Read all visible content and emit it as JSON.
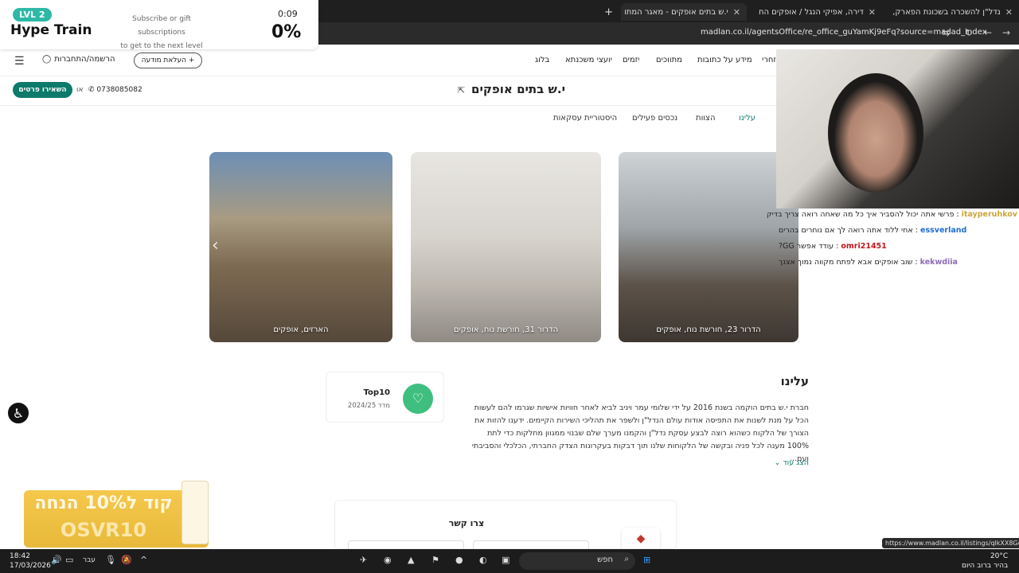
{
  "browser": {
    "tabs": [
      {
        "label": "נדל\"ן להשכרה בשכונת הפארק,"
      },
      {
        "label": "דירה, אפיקי הנגל / אופקים הח"
      },
      {
        "label": "י.ש בתים אופקים - מאגר המתו"
      }
    ],
    "url": "madlan.co.il/agentsOffice/re_office_guYamKj9eFq?source=madad_index"
  },
  "hype_train": {
    "level": "LVL 2",
    "title": "Hype Train",
    "subtitle_line1": "Subscribe or gift subscriptions",
    "subtitle_line2": "to get to the next level",
    "timer": "0:09",
    "percent": "0%"
  },
  "site_nav": {
    "links": [
      "בלוג",
      "יועצי משכנתא",
      "יזמים",
      "מתווכים",
      "מידע על כתובות",
      "זחרי"
    ],
    "login": "הרשמה/התחברות",
    "upload": "העלאת מודעה"
  },
  "office": {
    "name": "י.ש בתים אופקים",
    "leave_details": "השאירו פרטים",
    "or": "או",
    "phone": "0738085082"
  },
  "section_tabs": [
    "עלינו",
    "הצוות",
    "נכסים פעילים",
    "היסטוריית עסקאות"
  ],
  "cards": [
    {
      "caption": "הארזים, אופקים"
    },
    {
      "caption": "הדרור 31, חורשת נוח, אופקים"
    },
    {
      "caption": "הדרור 23, חורשת נוח, אופקים"
    }
  ],
  "about": {
    "title": "עלינו",
    "text": "חברת י.ש בתים הוקמה בשנת 2016 על ידי שלומי עמר ויניב לביא לאחר חוויות אישיות שגרמו להם לעשות הכל על מנת לשנות את התפיסה אודות עולם הנדל\"ן ולשפר את תהליכי השירות הקיימים. ידענו להזות את הצורך של הלקוח כשהוא רוצה לבצע עסקת נדל\"ן והקמנו מערך שלם שבנוי ממגוון מחלקות כדי לתת 100% מענה לכל פניה ובקשה של הלקוחות שלנו תוך דבקות בעקרונות הצדק החברתי, הכלכלי והסביבתי ועם...",
    "show_more": "הצג עוד",
    "badge_title": "Top10",
    "badge_sub": "מדד 2024/25"
  },
  "contact": {
    "title": "צרו קשר"
  },
  "ad": {
    "line1": "קוד ל10% הנחה",
    "line2": "OSVR10"
  },
  "chat": [
    {
      "user": "itayperuhkov",
      "msg": ": פרשי אתה יכול להסביר איך כל מה שאחה רואה צריך בדיק"
    },
    {
      "user": "essverland",
      "msg": ": אחי ללוד אתה רואה לך אם נוחרים בהרים"
    },
    {
      "user": "omri21451",
      "msg": ": עודד אפשר GG?"
    },
    {
      "user": "kekwdiia",
      "msg": ": שוב אופקים אבא לפתח מקווה נמוך אצנך"
    }
  ],
  "chat_colors": [
    "#c9a63a",
    "#1f6bd6",
    "#c4161c",
    "#8e6bb8"
  ],
  "status_url": "https://www.madlan.co.il/listings/qlkXX8GoEg0",
  "taskbar": {
    "time": "18:42",
    "date": "17/03/2026",
    "lang": "עבר",
    "search": "חפש",
    "temp": "20°C",
    "weather": "בהיר ברוב היום"
  }
}
